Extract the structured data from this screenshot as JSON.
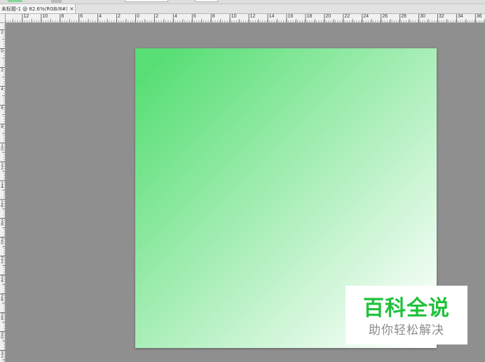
{
  "window": {
    "tab_title": "未标题-1 @ 82.6%(RGB/8#) *",
    "close_icon": "×"
  },
  "ruler": {
    "horizontal_labels": [
      "12",
      "10",
      "8",
      "6",
      "4",
      "2",
      "0",
      "2",
      "4",
      "6",
      "8",
      "10",
      "12",
      "14",
      "16",
      "18",
      "20",
      "22",
      "24",
      "26",
      "28",
      "30",
      "32",
      "34",
      "36"
    ],
    "vertical_labels": [
      "2",
      "0",
      "2",
      "4",
      "6",
      "8",
      "10",
      "12",
      "14",
      "16",
      "18",
      "20",
      "22",
      "24",
      "26",
      "28",
      "30",
      "32"
    ]
  },
  "watermark": {
    "title": "百科全说",
    "subtitle": "助你轻松解决"
  },
  "colors": {
    "canvas_background": "#8f8f8f",
    "document_gradient_start": "#57de74",
    "document_gradient_end": "#ffffff",
    "watermark_background": "#ffffff",
    "watermark_title": "#1fc23c",
    "watermark_subtitle": "#8c8c8c"
  }
}
